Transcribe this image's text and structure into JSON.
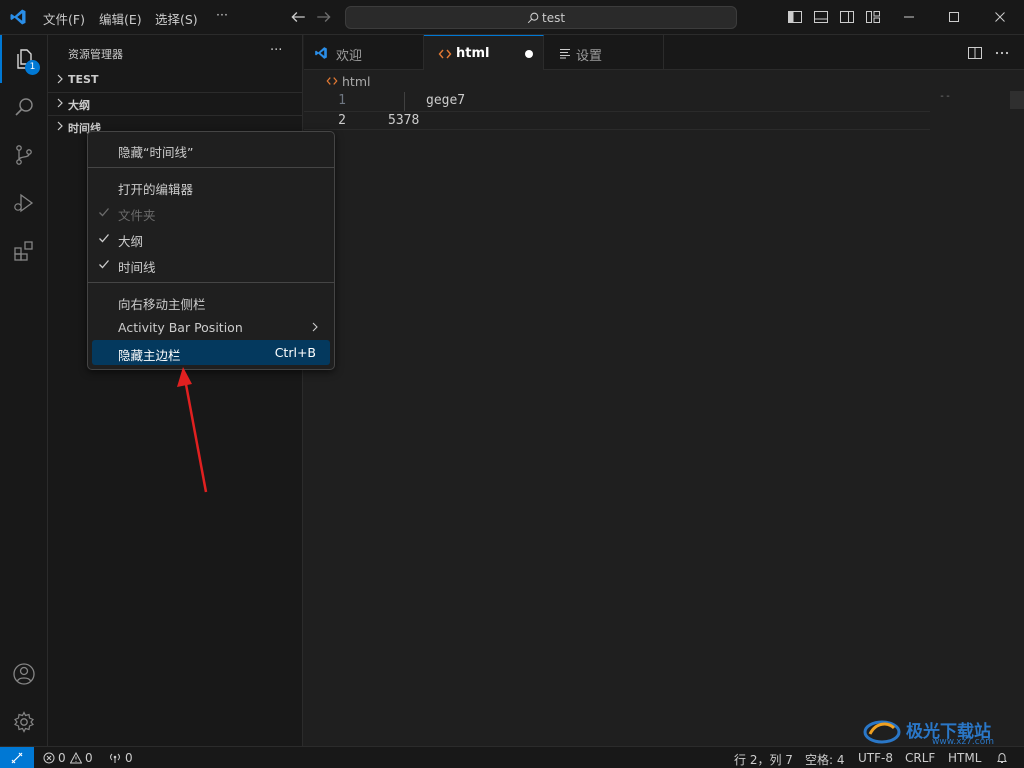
{
  "titlebar": {
    "menus": [
      "文件(F)",
      "编辑(E)",
      "选择(S)"
    ],
    "more": "···",
    "search_text": "test"
  },
  "activitybar": {
    "explorer_badge": "1"
  },
  "sidebar": {
    "title": "资源管理器",
    "more": "···",
    "sections": [
      "TEST",
      "大纲",
      "时间线"
    ]
  },
  "tabs": [
    {
      "label": "欢迎"
    },
    {
      "label": "html"
    },
    {
      "label": "设置"
    }
  ],
  "breadcrumb": "html",
  "editor": {
    "lines": [
      {
        "num": "1",
        "text": "gege7"
      },
      {
        "num": "2",
        "text": "5378"
      }
    ],
    "minimap_mark": "--"
  },
  "context_menu": {
    "items": [
      {
        "label": "隐藏“时间线”"
      },
      {
        "label": "打开的编辑器"
      },
      {
        "label": "文件夹",
        "checked": true,
        "disabled": true
      },
      {
        "label": "大纲",
        "checked": true
      },
      {
        "label": "时间线",
        "checked": true
      },
      {
        "label": "向右移动主侧栏"
      },
      {
        "label": "Activity Bar Position",
        "submenu": true
      },
      {
        "label": "隐藏主边栏",
        "shortcut": "Ctrl+B",
        "highlighted": true
      }
    ]
  },
  "statusbar": {
    "errors": "0",
    "warnings": "0",
    "ports": "0",
    "position": "行 2，列 7",
    "spaces": "空格: 4",
    "encoding": "UTF-8",
    "eol": "CRLF",
    "language": "HTML"
  },
  "watermark": {
    "name": "极光下载站",
    "url": "www.xz7.com"
  },
  "colors": {
    "accent": "#0078d4",
    "selection": "#04395e",
    "arrow": "#e02020",
    "html_icon": "#e37933"
  }
}
